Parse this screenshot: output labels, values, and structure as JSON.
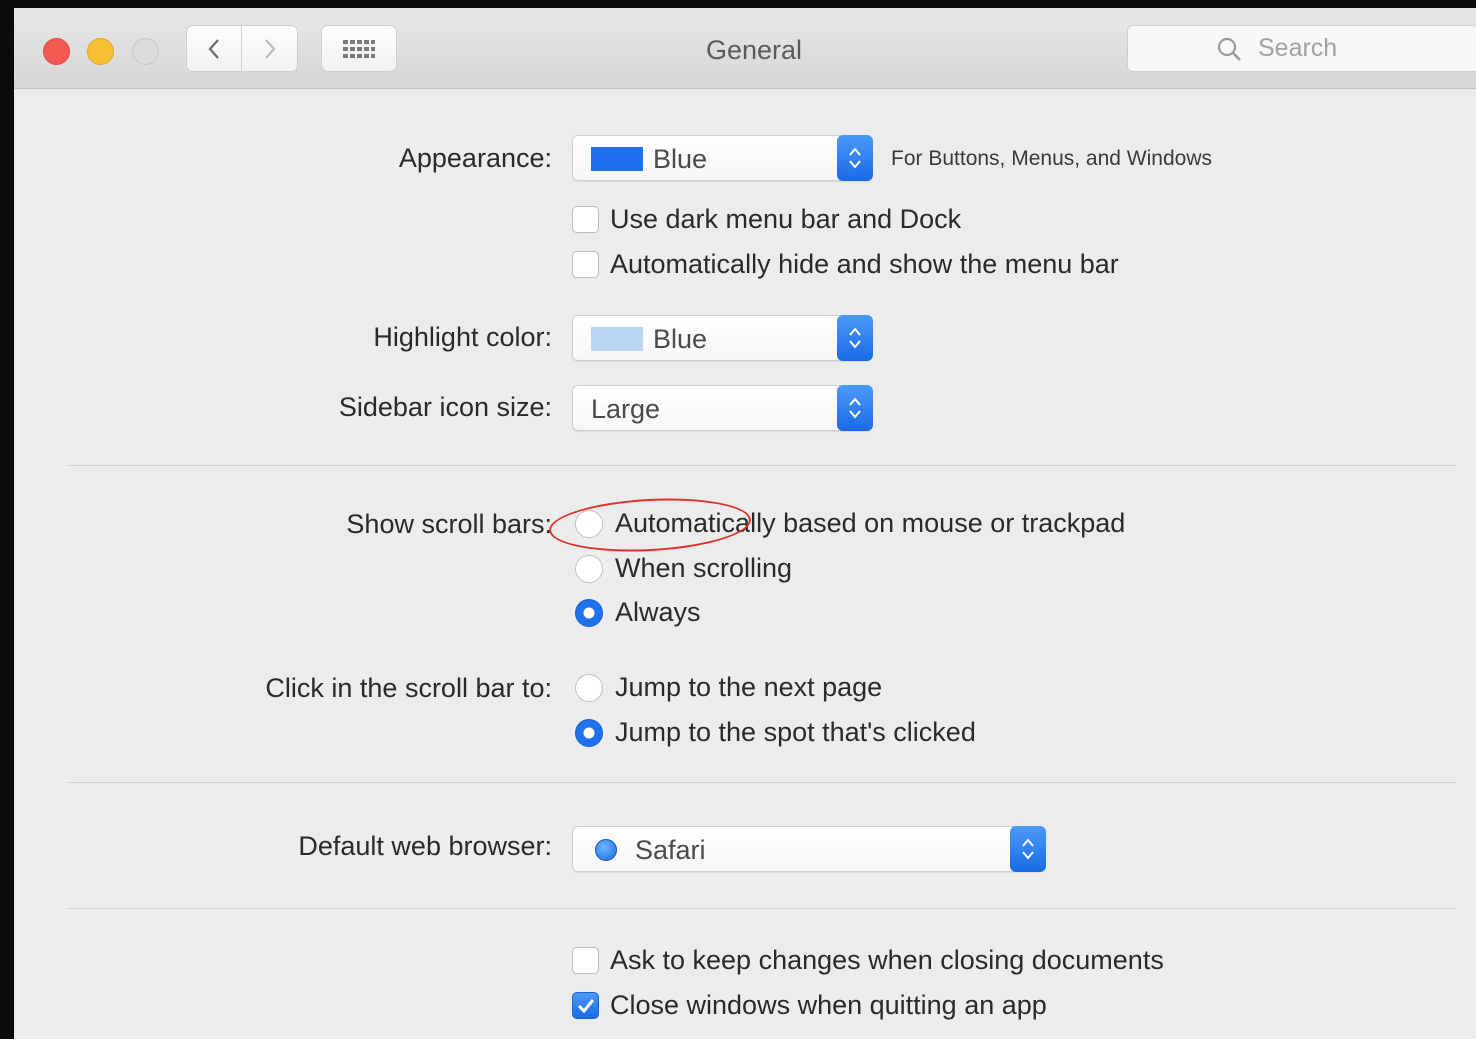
{
  "window": {
    "title": "General",
    "search": {
      "placeholder": "Search"
    }
  },
  "appearance": {
    "label": "Appearance:",
    "value": "Blue",
    "swatch_color": "#1f6ff0",
    "note": "For Buttons, Menus, and Windows",
    "options": [
      {
        "label": "Use dark menu bar and Dock",
        "checked": false
      },
      {
        "label": "Automatically hide and show the menu bar",
        "checked": false
      }
    ]
  },
  "highlight": {
    "label": "Highlight color:",
    "value": "Blue",
    "swatch_color": "#b9d7f5"
  },
  "sidebar_icon_size": {
    "label": "Sidebar icon size:",
    "value": "Large"
  },
  "scroll_bars": {
    "label": "Show scroll bars:",
    "options": [
      {
        "label": "Automatically based on mouse or trackpad",
        "selected": false
      },
      {
        "label": "When scrolling",
        "selected": false
      },
      {
        "label": "Always",
        "selected": true
      }
    ]
  },
  "click_scroll": {
    "label": "Click in the scroll bar to:",
    "options": [
      {
        "label": "Jump to the next page",
        "selected": false
      },
      {
        "label": "Jump to the spot that's clicked",
        "selected": true
      }
    ]
  },
  "browser": {
    "label": "Default web browser:",
    "value": "Safari"
  },
  "documents": {
    "options": [
      {
        "label": "Ask to keep changes when closing documents",
        "checked": false
      },
      {
        "label": "Close windows when quitting an app",
        "checked": true
      }
    ]
  },
  "colors": {
    "accent": "#1f72ec",
    "annotation": "#e0322a"
  }
}
